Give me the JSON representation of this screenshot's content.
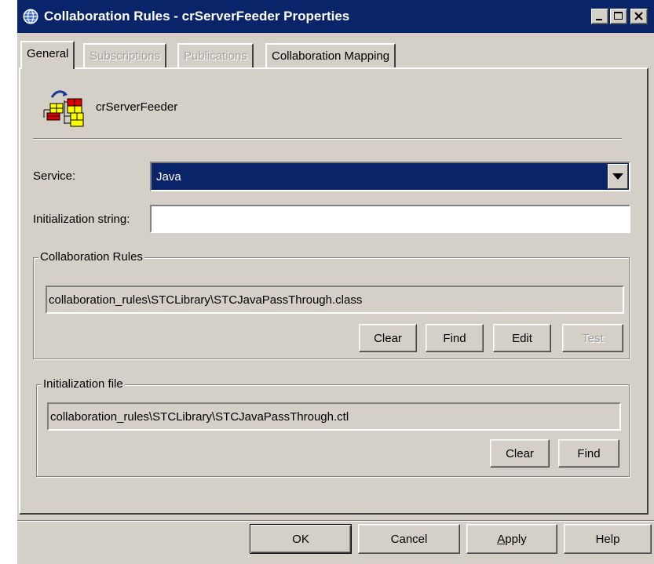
{
  "window": {
    "title": "Collaboration Rules - crServerFeeder Properties",
    "title_bar_color": "#0a246a",
    "icons": [
      "globe-icon",
      "minimize-icon",
      "maximize-icon",
      "close-icon"
    ]
  },
  "tabs": [
    {
      "label": "General",
      "state": "active"
    },
    {
      "label": "Subscriptions",
      "state": "disabled"
    },
    {
      "label": "Publications",
      "state": "disabled"
    },
    {
      "label": "Collaboration Mapping",
      "state": "enabled"
    }
  ],
  "general": {
    "object_name": "crServerFeeder",
    "object_icon": "collaboration-rules-icon",
    "service_label": "Service:",
    "service_value": "Java",
    "init_string_label": "Initialization string:",
    "init_string_value": "",
    "collab_rules_group": {
      "legend": "Collaboration Rules",
      "path": "collaboration_rules\\STCLibrary\\STCJavaPassThrough.class",
      "buttons": [
        "Clear",
        "Find",
        "Edit",
        "Test"
      ],
      "disabled_buttons": [
        "Test"
      ]
    },
    "init_file_group": {
      "legend": "Initialization file",
      "path": "collaboration_rules\\STCLibrary\\STCJavaPassThrough.ctl",
      "buttons": [
        "Clear",
        "Find"
      ]
    }
  },
  "dialog_buttons": {
    "ok": "OK",
    "cancel": "Cancel",
    "apply_prefix": "",
    "apply_accel": "A",
    "apply_rest": "pply",
    "help": "Help"
  }
}
